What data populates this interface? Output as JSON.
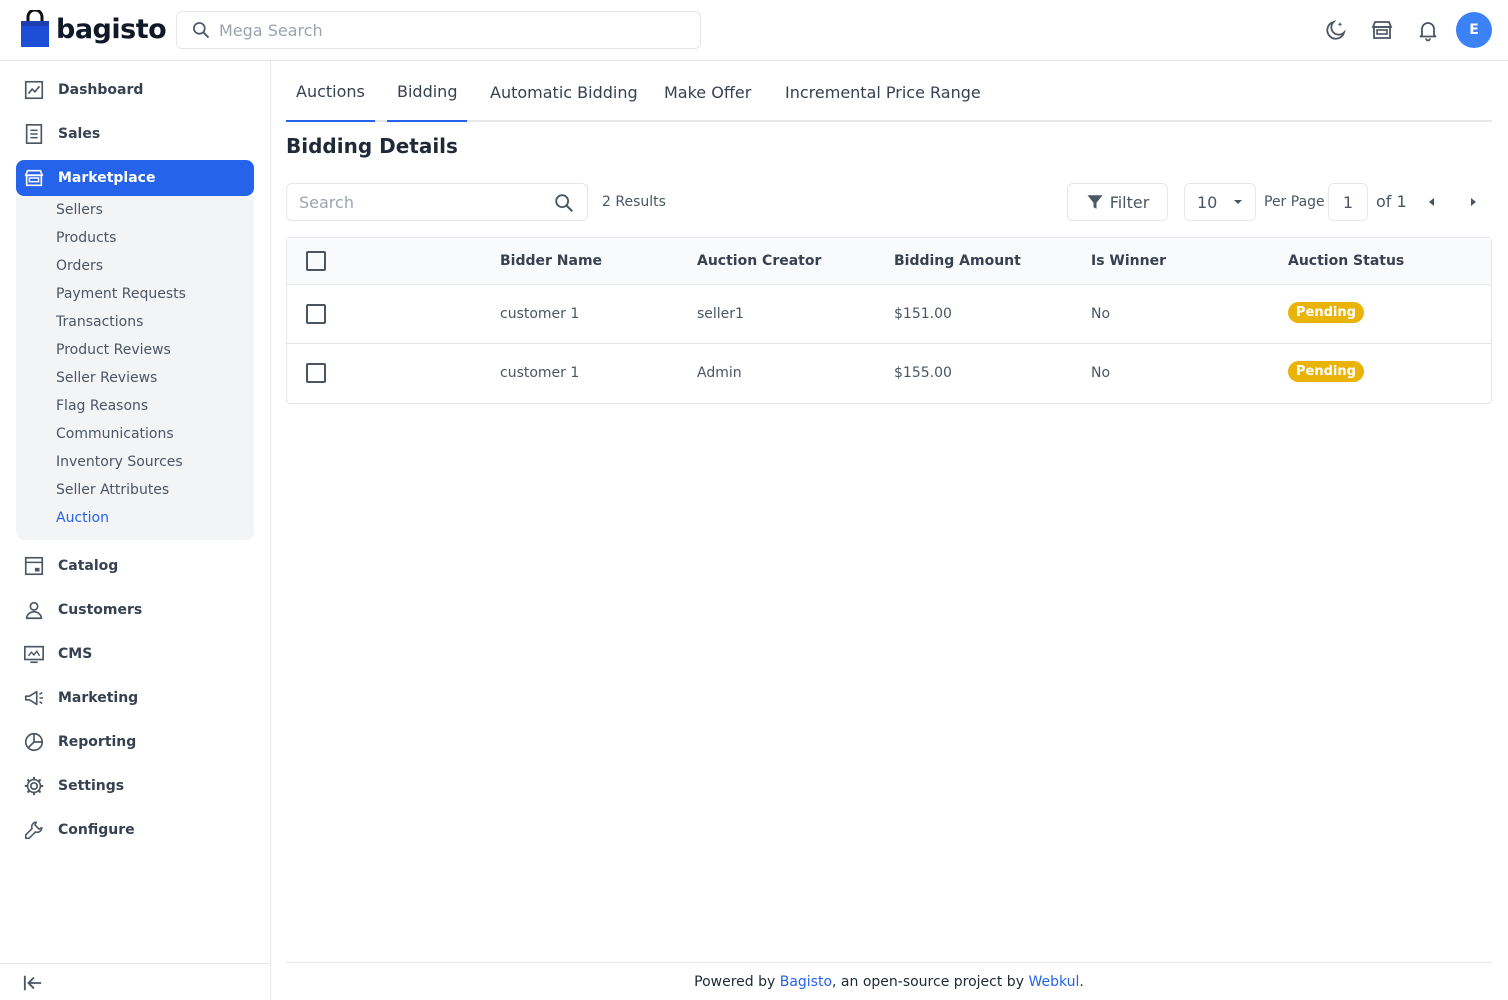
{
  "header": {
    "logo_text": "bagisto",
    "search_placeholder": "Mega Search",
    "avatar_initial": "E"
  },
  "sidebar": {
    "items": [
      {
        "label": "Dashboard",
        "icon": "dashboard-icon"
      },
      {
        "label": "Sales",
        "icon": "sales-icon"
      },
      {
        "label": "Marketplace",
        "icon": "marketplace-icon",
        "active": true
      },
      {
        "label": "Catalog",
        "icon": "catalog-icon"
      },
      {
        "label": "Customers",
        "icon": "customers-icon"
      },
      {
        "label": "CMS",
        "icon": "cms-icon"
      },
      {
        "label": "Marketing",
        "icon": "marketing-icon"
      },
      {
        "label": "Reporting",
        "icon": "reporting-icon"
      },
      {
        "label": "Settings",
        "icon": "settings-icon"
      },
      {
        "label": "Configure",
        "icon": "configure-icon"
      }
    ],
    "marketplace_sub": [
      "Sellers",
      "Products",
      "Orders",
      "Payment Requests",
      "Transactions",
      "Product Reviews",
      "Seller Reviews",
      "Flag Reasons",
      "Communications",
      "Inventory Sources",
      "Seller Attributes",
      "Auction"
    ]
  },
  "tabs": [
    "Auctions",
    "Bidding",
    "Automatic Bidding",
    "Make Offer",
    "Incremental Price Range"
  ],
  "page_title": "Bidding Details",
  "toolbar": {
    "search_placeholder": "Search",
    "results": "2 Results",
    "filter_label": "Filter",
    "per_page_value": "10",
    "per_page_label": "Per Page",
    "current_page": "1",
    "of_pages": "of 1"
  },
  "table": {
    "headers": [
      "Bidder Name",
      "Auction Creator",
      "Bidding Amount",
      "Is Winner",
      "Auction Status"
    ],
    "rows": [
      [
        "customer 1",
        "seller1",
        "$151.00",
        "No",
        "Pending"
      ],
      [
        "customer 1",
        "Admin",
        "$155.00",
        "No",
        "Pending"
      ]
    ]
  },
  "footer": {
    "prefix": "Powered by ",
    "link1": "Bagisto",
    "middle": ", an open-source project by ",
    "link2": "Webkul",
    "suffix": "."
  },
  "colors": {
    "accent": "#2563eb",
    "pending_badge": "#eab308",
    "avatar": "#3b82f6"
  }
}
